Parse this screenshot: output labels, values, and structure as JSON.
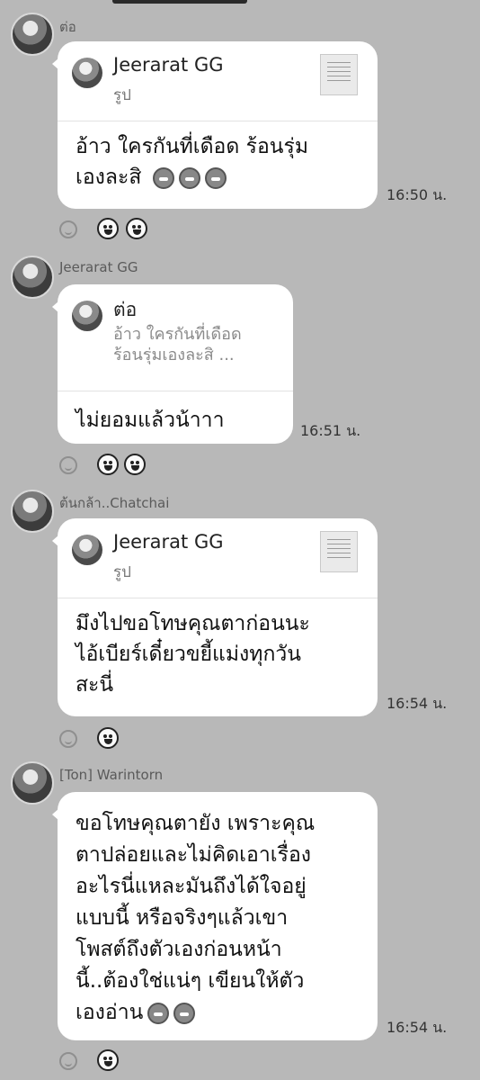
{
  "messages": [
    {
      "sender": "ต่อ",
      "reply": {
        "name": "Jeerarat GG",
        "subtitle": "รูป"
      },
      "text_lines": [
        "อ้าว ใครกันที่เดือด ร้อนรุ่ม",
        "เองละสิ"
      ],
      "emojis": [
        "rolling-laughing-icon",
        "rolling-laughing-icon",
        "rolling-laughing-icon"
      ],
      "time": "16:50 น.",
      "reactions": [
        "grinning-squint-icon",
        "laughing-icon"
      ]
    },
    {
      "sender": "Jeerarat GG",
      "reply": {
        "name": "ต่อ",
        "text_lines": [
          "อ้าว ใครกันที่เดือด",
          "ร้อนรุ่มเองละสิ ..."
        ]
      },
      "text_lines": [
        "ไม่ยอมแล้วน้าาา"
      ],
      "time": "16:51 น.",
      "reactions": [
        "grinning-squint-icon",
        "grinning-squint-icon"
      ]
    },
    {
      "sender": "ต้นกล้า..Chatchai",
      "reply": {
        "name": "Jeerarat GG",
        "subtitle": "รูป"
      },
      "text_lines": [
        "มึงไปขอโทษคุณตาก่อนนะ",
        "ไอ้เบียร์เดี๋ยวขยี้แม่งทุกวัน",
        "สะนี่"
      ],
      "time": "16:54 น.",
      "reactions": [
        "kiss-wink-icon"
      ]
    },
    {
      "sender": "[Ton] Warintorn",
      "text_lines": [
        "ขอโทษคุณตายัง เพราะคุณ",
        "ตาปล่อยและไม่คิดเอาเรื่อง",
        "อะไรนี่แหละมันถึงได้ใจอยู่",
        "แบบนี้ หรือจริงๆแล้วเขา",
        "โพสต์ถึงตัวเองก่อนหน้า",
        "นี้..ต้องใช่แน่ๆ เขียนให้ตัว",
        "เองอ่าน"
      ],
      "emojis": [
        "rolling-laughing-icon",
        "rolling-laughing-icon"
      ],
      "time": "16:54 น.",
      "reactions": [
        "grinning-squint-icon"
      ]
    }
  ]
}
